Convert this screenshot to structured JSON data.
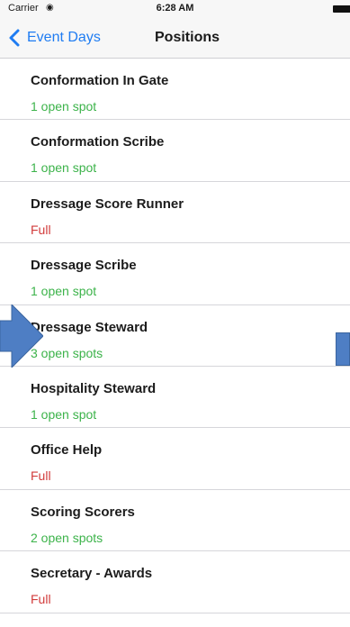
{
  "status_bar": {
    "carrier": "Carrier",
    "time": "6:28 AM"
  },
  "nav": {
    "back_label": "Event Days",
    "title": "Positions"
  },
  "positions": [
    {
      "name": "Conformation In Gate",
      "status": "1 open spot",
      "state": "open"
    },
    {
      "name": "Conformation Scribe",
      "status": "1 open spot",
      "state": "open"
    },
    {
      "name": "Dressage Score Runner",
      "status": "Full",
      "state": "full"
    },
    {
      "name": "Dressage Scribe",
      "status": "1 open spot",
      "state": "open"
    },
    {
      "name": "Dressage Steward",
      "status": "3 open spots",
      "state": "open"
    },
    {
      "name": "Hospitality Steward",
      "status": "1 open spot",
      "state": "open"
    },
    {
      "name": "Office Help",
      "status": "Full",
      "state": "full"
    },
    {
      "name": "Scoring Scorers",
      "status": "2 open spots",
      "state": "open"
    },
    {
      "name": "Secretary - Awards",
      "status": "Full",
      "state": "full"
    }
  ],
  "colors": {
    "accent": "#1f7cf2",
    "open": "#3cb34a",
    "full": "#d23b3b",
    "annotation_arrow": "#4e7ec4"
  },
  "icons": {
    "back": "chevron-left-icon",
    "wifi": "wifi-icon",
    "battery": "battery-icon",
    "annotation": "arrow-right-icon"
  }
}
